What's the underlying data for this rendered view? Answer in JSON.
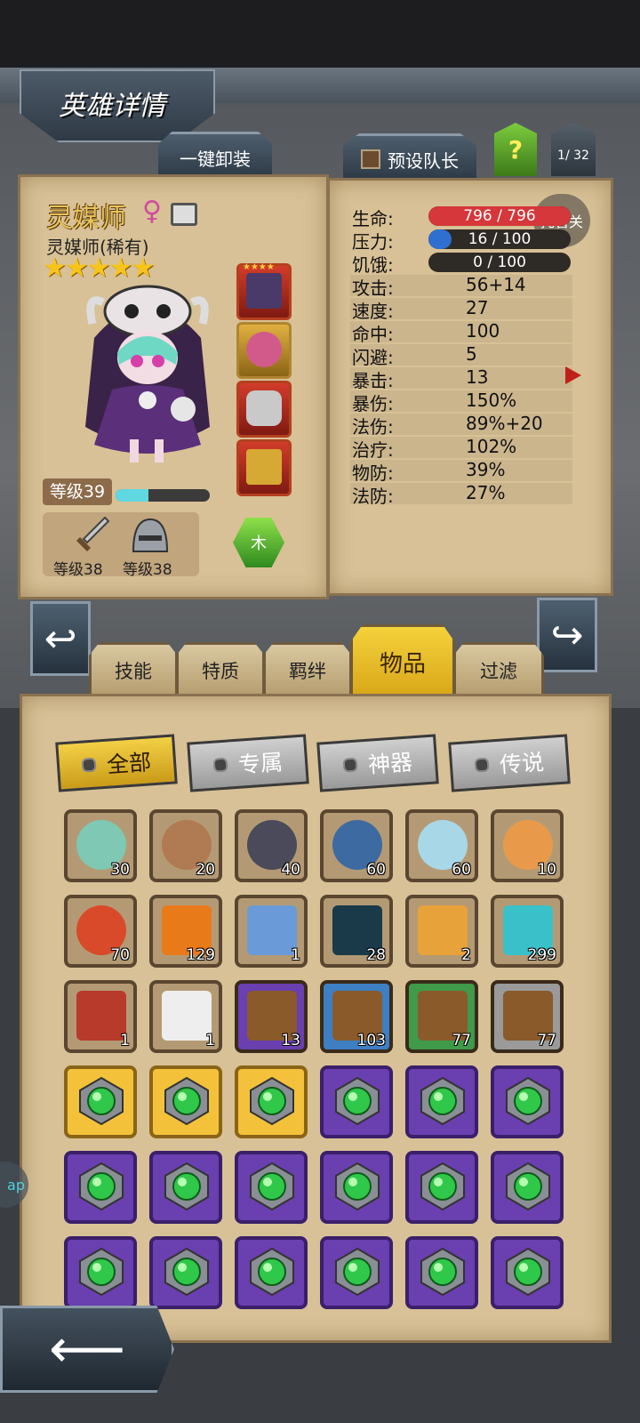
{
  "header": {
    "title": "英雄详情",
    "unequip_all": "一键卸装",
    "preset_captain": "预设队长",
    "help": "?",
    "page_indicator": "1/ 32"
  },
  "hero": {
    "name": "灵媒师",
    "gender_symbol": "♀",
    "rarity": "灵媒师(稀有)",
    "stars": "★★★★★",
    "level_label": "等级39",
    "xp_fraction": 0.35,
    "weapon_level": "等级38",
    "armor_level": "等级38",
    "element": "木",
    "equip_slot_stars": "★★★★"
  },
  "stats": {
    "auto_toggle": "托管关",
    "hp": {
      "label": "生命:",
      "value": "796 / 796",
      "fraction": 1.0,
      "color": "#d5373a"
    },
    "stress": {
      "label": "压力:",
      "value": "16 / 100",
      "fraction": 0.16,
      "color": "#2f6fd0"
    },
    "hunger": {
      "label": "饥饿:",
      "value": "0 / 100",
      "fraction": 0.0,
      "color": "#888888"
    },
    "rows": [
      {
        "label": "攻击:",
        "value": "56+14"
      },
      {
        "label": "速度:",
        "value": "27"
      },
      {
        "label": "命中:",
        "value": "100"
      },
      {
        "label": "闪避:",
        "value": "5"
      },
      {
        "label": "暴击:",
        "value": "13"
      },
      {
        "label": "暴伤:",
        "value": "150%"
      },
      {
        "label": "法伤:",
        "value": "89%+20"
      },
      {
        "label": "治疗:",
        "value": "102%"
      },
      {
        "label": "物防:",
        "value": "39%"
      },
      {
        "label": "法防:",
        "value": "27%"
      }
    ]
  },
  "tabs": [
    {
      "label": "技能"
    },
    {
      "label": "特质"
    },
    {
      "label": "羁绊"
    },
    {
      "label": "物品"
    },
    {
      "label": "过滤"
    }
  ],
  "filters": [
    {
      "label": "全部"
    },
    {
      "label": "专属"
    },
    {
      "label": "神器"
    },
    {
      "label": "传说"
    }
  ],
  "inventory": {
    "row1": [
      {
        "name": "hero-shard-green-hair",
        "count": "30"
      },
      {
        "name": "hero-shard-brown-hair",
        "count": "20"
      },
      {
        "name": "hero-shard-dark-hair",
        "count": "40"
      },
      {
        "name": "hero-shard-blue-hair",
        "count": "60"
      },
      {
        "name": "hero-shard-elf",
        "count": "60"
      },
      {
        "name": "hero-shard-orange-hair",
        "count": "10"
      }
    ],
    "row2": [
      {
        "name": "hero-shard-red-hair",
        "count": "70"
      },
      {
        "name": "orange-gem",
        "count": "129"
      },
      {
        "name": "blue-crystal-pile",
        "count": "1"
      },
      {
        "name": "dark-rune-stone",
        "count": "28"
      },
      {
        "name": "golden-feather",
        "count": "2"
      },
      {
        "name": "blue-potion",
        "count": "299"
      }
    ],
    "row3": [
      {
        "name": "skull-tome",
        "count": "1"
      },
      {
        "name": "white-feather",
        "count": "1"
      },
      {
        "name": "purple-chest",
        "count": "13"
      },
      {
        "name": "blue-chest",
        "count": "103"
      },
      {
        "name": "green-chest",
        "count": "77"
      },
      {
        "name": "grey-chest",
        "count": "77"
      }
    ],
    "orb_row_frames": [
      [
        "gold",
        "gold",
        "gold",
        "purple",
        "purple",
        "purple"
      ],
      [
        "purple",
        "purple",
        "purple",
        "purple",
        "purple",
        "purple"
      ],
      [
        "purple",
        "purple",
        "purple",
        "purple",
        "purple",
        "purple"
      ]
    ],
    "colors": {
      "gold": "#f3c23a",
      "purple": "#6a3fb0",
      "blue": "#3d7fc2",
      "green": "#3f9a4a",
      "grey": "#9a9a9a",
      "brown": "#5a4630"
    }
  },
  "side_bubble": "ap",
  "back_arrow": "⟵"
}
